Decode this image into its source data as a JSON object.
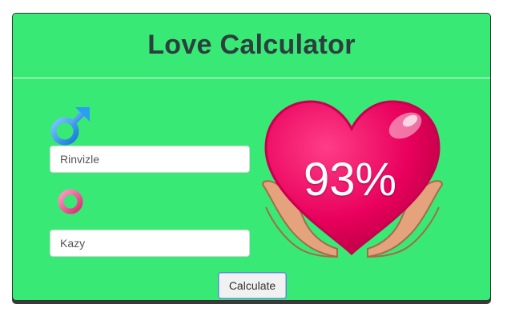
{
  "app": {
    "title": "Love Calculator"
  },
  "form": {
    "male_name": "Rinvizle",
    "female_name": "Kazy",
    "calculate_label": "Calculate"
  },
  "result": {
    "percent_text": "93%"
  },
  "icons": {
    "male": "male-symbol-icon",
    "female": "female-symbol-icon",
    "heart": "heart-in-hands-icon"
  },
  "colors": {
    "background": "#39e975",
    "heart": "#e8005c",
    "male": "#2a9df4",
    "female": "#e34a86"
  }
}
